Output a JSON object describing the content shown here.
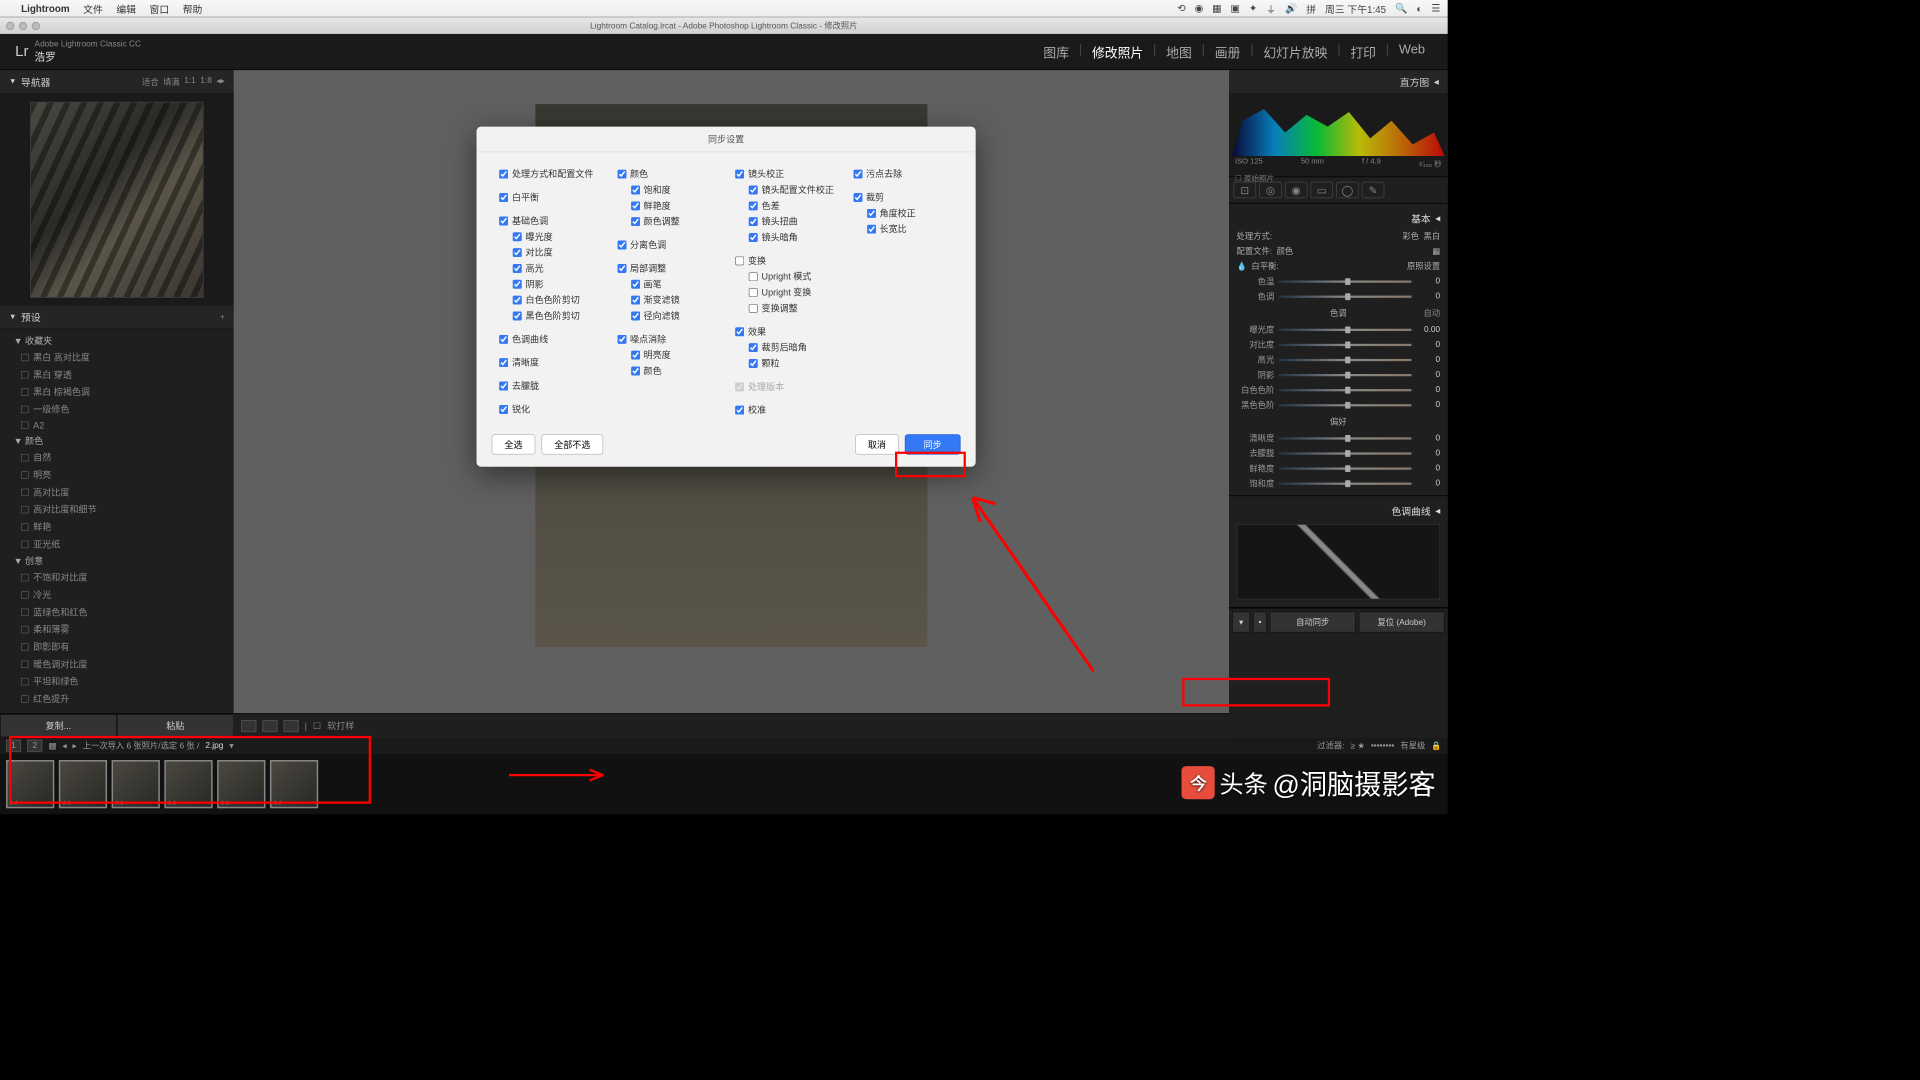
{
  "menubar": {
    "appname": "Lightroom",
    "items": [
      "文件",
      "编辑",
      "窗口",
      "帮助"
    ],
    "clock": "周三 下午1:45"
  },
  "titlebar": "Lightroom Catalog.lrcat - Adobe Photoshop Lightroom Classic - 修改照片",
  "lr": {
    "brand": "Adobe Lightroom Classic CC",
    "user": "浩罗",
    "nav": [
      "图库",
      "修改照片",
      "地图",
      "画册",
      "幻灯片放映",
      "打印",
      "Web"
    ],
    "active_nav": 1
  },
  "navigator": {
    "title": "导航器",
    "opts": [
      "适合",
      "填满",
      "1:1",
      "1:8"
    ]
  },
  "presets": {
    "title": "预设",
    "groups": [
      {
        "name": "收藏夹",
        "items": [
          "黑白 高对比度",
          "黑白 穿透",
          "黑白 棕褐色调",
          "一级修色",
          "A2"
        ]
      },
      {
        "name": "颜色",
        "items": [
          "自然",
          "明亮",
          "高对比度",
          "高对比度和细节",
          "鲜艳",
          "亚光纸"
        ]
      },
      {
        "name": "创意",
        "items": [
          "不饱和对比度",
          "冷光",
          "蓝绿色和红色",
          "柔和薄雾",
          "即影即有",
          "暖色调对比度",
          "平坦和绿色",
          "红色提升"
        ]
      }
    ]
  },
  "left_buttons": {
    "copy": "复制...",
    "paste": "粘贴"
  },
  "toolbar": {
    "softproof": "软打样"
  },
  "histogram": {
    "title": "直方图",
    "iso": "ISO 125",
    "focal": "50 mm",
    "aperture": "f / 4.9",
    "shutter": "¹⁄₄₀₀ 秒",
    "original": "原始照片"
  },
  "basic": {
    "title": "基本",
    "treatment": "处理方式:",
    "color_l": "彩色",
    "bw_l": "黑白",
    "profile": "配置文件:",
    "profile_val": "颜色",
    "wb": "白平衡:",
    "wb_val": "原照设置",
    "temp": "色温",
    "tint": "色调",
    "tone_head": "色调",
    "auto": "自动",
    "exposure": "曝光度",
    "contrast": "对比度",
    "highlights": "高光",
    "shadows": "阴影",
    "whites": "白色色阶",
    "blacks": "黑色色阶",
    "presence_head": "偏好",
    "clarity": "清晰度",
    "dehaze": "去朦胧",
    "vibrance": "鲜艳度",
    "saturation": "饱和度"
  },
  "curve": {
    "title": "色调曲线"
  },
  "right_buttons": {
    "sync": "自动同步",
    "reset": "复位 (Adobe)"
  },
  "filmstrip": {
    "info": "上一次导入  6 张照片/选定 6 张 /",
    "file": "2.jpg",
    "filter": "过滤器:",
    "filter2": "有星级"
  },
  "dialog": {
    "title": "同步设置",
    "col1": [
      {
        "t": "处理方式和配置文件",
        "c": true
      },
      {
        "t": "白平衡",
        "c": true
      },
      {
        "t": "基础色调",
        "c": true
      },
      {
        "t": "曝光度",
        "c": true,
        "s": true
      },
      {
        "t": "对比度",
        "c": true,
        "s": true
      },
      {
        "t": "高光",
        "c": true,
        "s": true
      },
      {
        "t": "阴影",
        "c": true,
        "s": true
      },
      {
        "t": "白色色阶剪切",
        "c": true,
        "s": true
      },
      {
        "t": "黑色色阶剪切",
        "c": true,
        "s": true
      },
      {
        "t": "色调曲线",
        "c": true
      },
      {
        "t": "清晰度",
        "c": true
      },
      {
        "t": "去朦胧",
        "c": true
      },
      {
        "t": "锐化",
        "c": true
      }
    ],
    "col2": [
      {
        "t": "颜色",
        "c": true
      },
      {
        "t": "饱和度",
        "c": true,
        "s": true
      },
      {
        "t": "鲜艳度",
        "c": true,
        "s": true
      },
      {
        "t": "颜色调整",
        "c": true,
        "s": true
      },
      {
        "t": "分离色调",
        "c": true
      },
      {
        "t": "局部调整",
        "c": true
      },
      {
        "t": "画笔",
        "c": true,
        "s": true
      },
      {
        "t": "渐变滤镜",
        "c": true,
        "s": true
      },
      {
        "t": "径向滤镜",
        "c": true,
        "s": true
      },
      {
        "t": "噪点消除",
        "c": true
      },
      {
        "t": "明亮度",
        "c": true,
        "s": true
      },
      {
        "t": "颜色",
        "c": true,
        "s": true
      }
    ],
    "col3": [
      {
        "t": "镜头校正",
        "c": true
      },
      {
        "t": "镜头配置文件校正",
        "c": true,
        "s": true
      },
      {
        "t": "色差",
        "c": true,
        "s": true
      },
      {
        "t": "镜头扭曲",
        "c": true,
        "s": true
      },
      {
        "t": "镜头暗角",
        "c": true,
        "s": true
      },
      {
        "t": "变换",
        "c": false
      },
      {
        "t": "Upright 模式",
        "c": false,
        "s": true
      },
      {
        "t": "Upright 变换",
        "c": false,
        "s": true
      },
      {
        "t": "变换调整",
        "c": false,
        "s": true
      },
      {
        "t": "效果",
        "c": true
      },
      {
        "t": "裁剪后暗角",
        "c": true,
        "s": true
      },
      {
        "t": "颗粒",
        "c": true,
        "s": true
      },
      {
        "t": "处理版本",
        "c": true,
        "d": true
      },
      {
        "t": "校准",
        "c": true
      }
    ],
    "col4": [
      {
        "t": "污点去除",
        "c": true
      },
      {
        "t": "裁剪",
        "c": true
      },
      {
        "t": "角度校正",
        "c": true,
        "s": true
      },
      {
        "t": "长宽比",
        "c": true,
        "s": true
      }
    ],
    "select_all": "全选",
    "select_none": "全部不选",
    "cancel": "取消",
    "sync": "同步"
  },
  "watermark": "@洞脑摄影客",
  "watermark_brand": "头条"
}
